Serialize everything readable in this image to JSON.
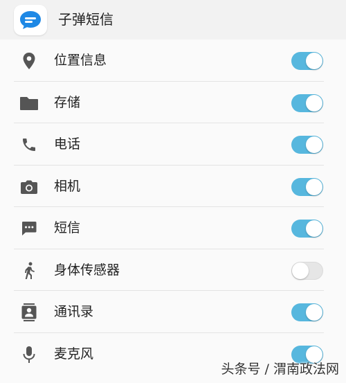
{
  "header": {
    "app_name": "子弹短信",
    "app_icon": "chat-bubble-icon",
    "accent_color": "#1e88e5"
  },
  "permissions": [
    {
      "label": "位置信息",
      "icon": "location-pin-icon",
      "enabled": true
    },
    {
      "label": "存储",
      "icon": "folder-icon",
      "enabled": true
    },
    {
      "label": "电话",
      "icon": "phone-icon",
      "enabled": true
    },
    {
      "label": "相机",
      "icon": "camera-icon",
      "enabled": true
    },
    {
      "label": "短信",
      "icon": "message-icon",
      "enabled": true
    },
    {
      "label": "身体传感器",
      "icon": "walking-person-icon",
      "enabled": false
    },
    {
      "label": "通讯录",
      "icon": "contacts-icon",
      "enabled": true
    },
    {
      "label": "麦克风",
      "icon": "microphone-icon",
      "enabled": true
    }
  ],
  "colors": {
    "toggle_on": "#57b7de",
    "toggle_off": "#e6e6e6",
    "icon_gray": "#555555"
  },
  "watermark": "头条号 / 渭南政法网"
}
